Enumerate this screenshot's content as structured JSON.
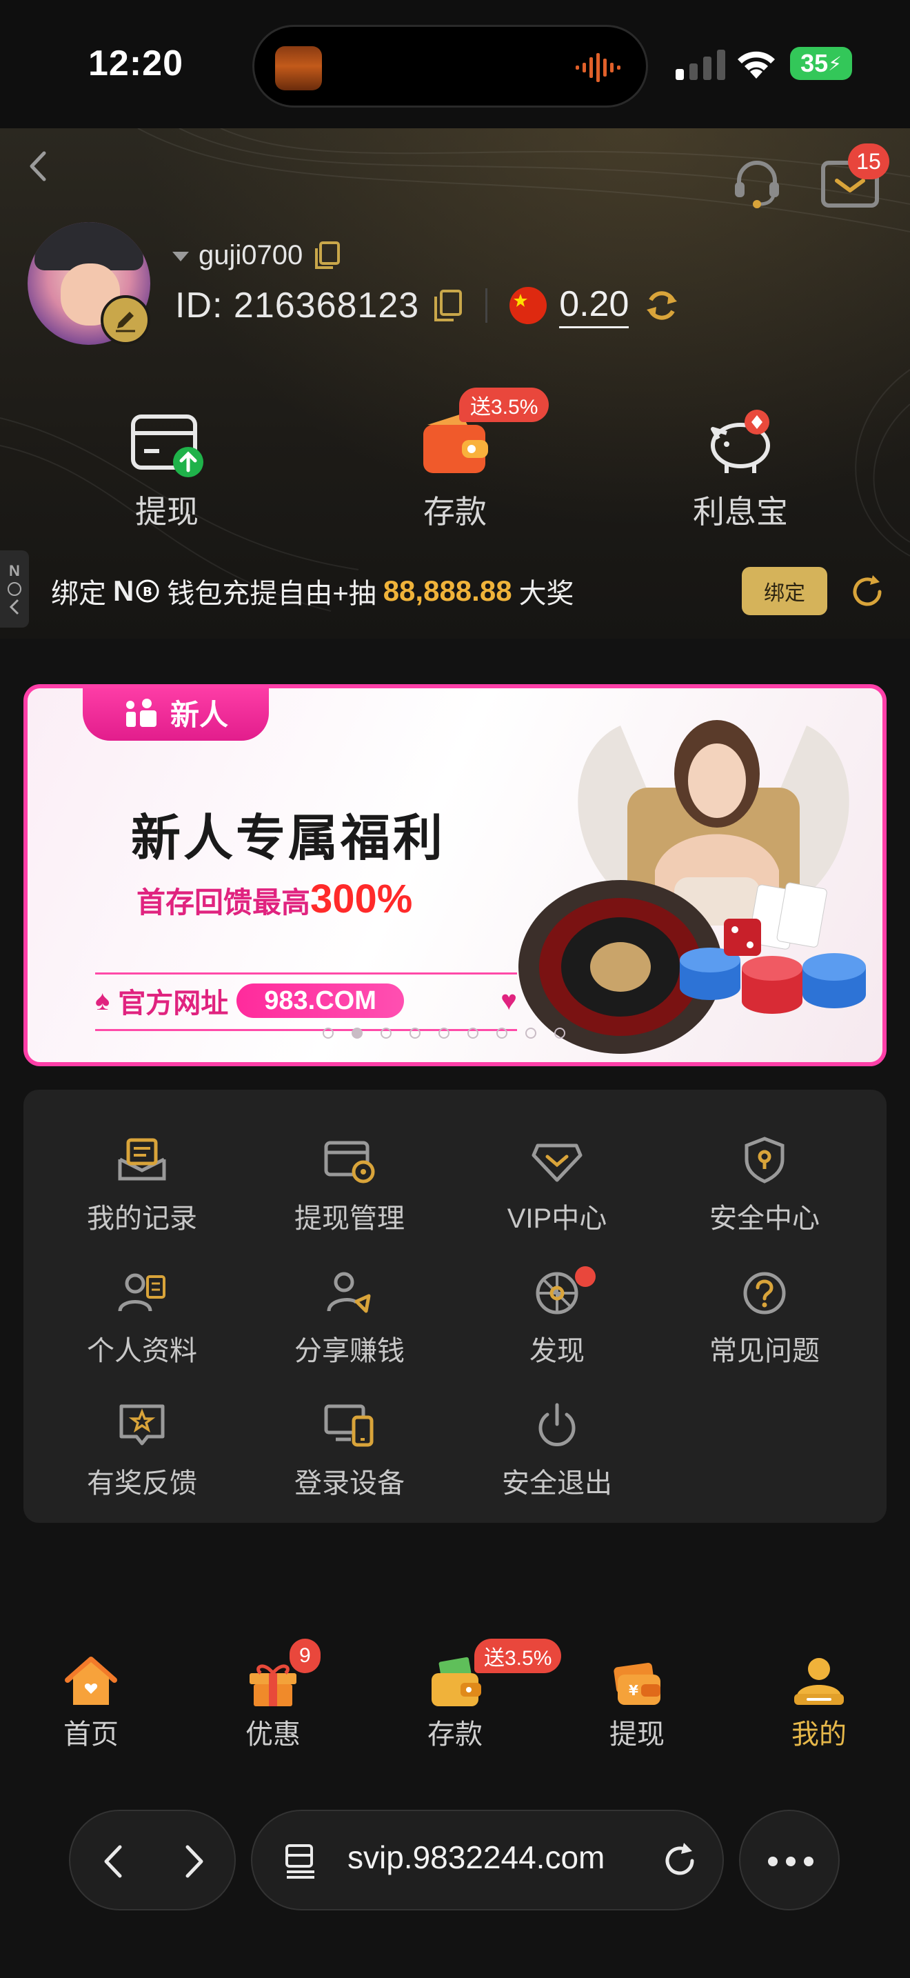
{
  "status_bar": {
    "time": "12:20",
    "battery": "35",
    "icons": [
      "album-art-icon",
      "audio-waveform-icon",
      "cellular-signal-icon",
      "wifi-icon",
      "battery-charging-icon"
    ]
  },
  "header": {
    "mail_badge": "15",
    "username": "guji0700",
    "id_text": "ID: 216368123",
    "balance": "0.20",
    "currency_flag": "china-flag-icon"
  },
  "quick_actions": {
    "withdraw": "提现",
    "deposit": "存款",
    "deposit_badge": "送3.5%",
    "interest": "利息宝"
  },
  "bind_bar": {
    "side_tab": "N",
    "prefix": "绑定",
    "brand": "N",
    "middle": "钱包充提自由+抽",
    "amount": "88,888.88",
    "suffix": "大奖",
    "button": "绑定"
  },
  "banner": {
    "tag": "新人",
    "title": "新人专属福利",
    "subtitle_prefix": "首存回馈最高",
    "subtitle_highlight": "300%",
    "url_label": "官方网址",
    "url": "983.COM",
    "dots_total": 9,
    "dots_active": 2
  },
  "menu": {
    "items": [
      {
        "label": "我的记录",
        "icon": "records-icon"
      },
      {
        "label": "提现管理",
        "icon": "withdraw-manage-icon"
      },
      {
        "label": "VIP中心",
        "icon": "vip-icon"
      },
      {
        "label": "安全中心",
        "icon": "shield-icon"
      },
      {
        "label": "个人资料",
        "icon": "profile-icon"
      },
      {
        "label": "分享赚钱",
        "icon": "share-icon"
      },
      {
        "label": "发现",
        "icon": "discover-icon"
      },
      {
        "label": "常见问题",
        "icon": "question-icon"
      },
      {
        "label": "有奖反馈",
        "icon": "feedback-icon"
      },
      {
        "label": "登录设备",
        "icon": "devices-icon"
      },
      {
        "label": "安全退出",
        "icon": "power-icon"
      }
    ]
  },
  "tabbar": {
    "home": "首页",
    "promo": "优惠",
    "promo_badge": "9",
    "deposit": "存款",
    "deposit_badge": "送3.5%",
    "withdraw": "提现",
    "mine": "我的",
    "active_color": "#e6b84a"
  },
  "browser": {
    "url": "svip.9832244.com"
  },
  "colors": {
    "accent_gold": "#d5b35a",
    "badge_red": "#e9473c",
    "banner_pink": "#ff3fa8"
  }
}
